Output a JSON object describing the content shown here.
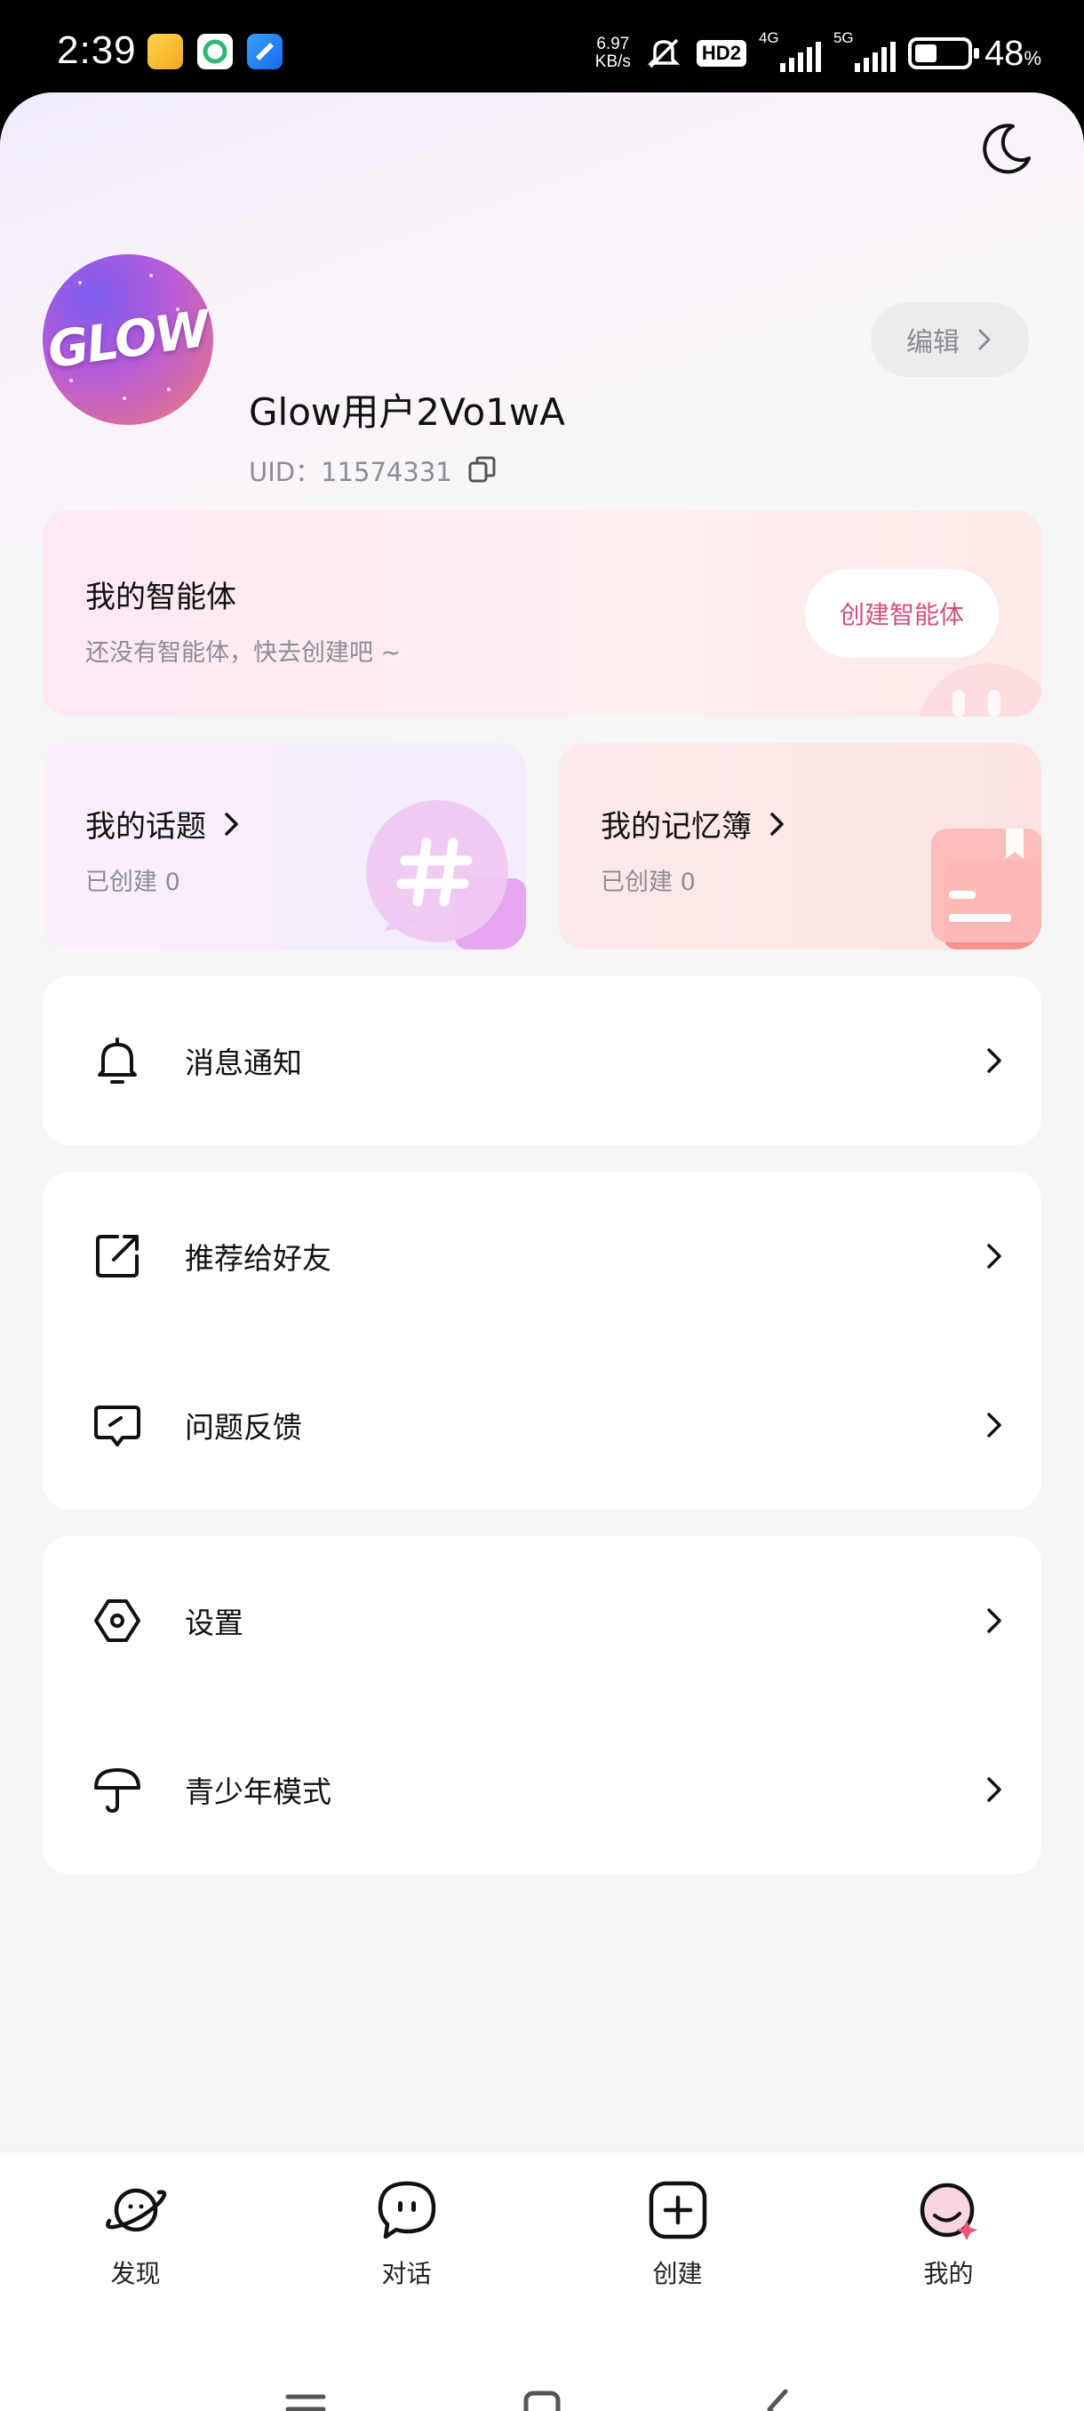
{
  "status_bar": {
    "time": "2:39",
    "net_speed_value": "6.97",
    "net_speed_unit": "KB/s",
    "hd_label": "HD2",
    "net1": "4G",
    "net2": "5G",
    "battery_value": "48",
    "battery_unit": "%",
    "battery_level": 0.48
  },
  "profile": {
    "username": "Glow用户2Vo1wA",
    "uid_label": "UID：",
    "uid_value": "11574331",
    "edit_label": "编辑",
    "avatar_logo": "GLOW"
  },
  "agents": {
    "title": "我的智能体",
    "subtitle": "还没有智能体，快去创建吧 ~",
    "create_label": "创建智能体"
  },
  "topics": {
    "title": "我的话题",
    "subtitle": "已创建 0"
  },
  "memo": {
    "title": "我的记忆簿",
    "subtitle": "已创建 0"
  },
  "menu_group1": [
    {
      "label": "消息通知",
      "icon": "bell-icon"
    }
  ],
  "menu_group2": [
    {
      "label": "推荐给好友",
      "icon": "share-icon"
    },
    {
      "label": "问题反馈",
      "icon": "feedback-icon"
    }
  ],
  "menu_group3": [
    {
      "label": "设置",
      "icon": "settings-icon"
    },
    {
      "label": "青少年模式",
      "icon": "umbrella-icon"
    }
  ],
  "bottom_nav": [
    {
      "label": "发现",
      "icon": "planet-icon"
    },
    {
      "label": "对话",
      "icon": "chat-icon"
    },
    {
      "label": "创建",
      "icon": "plus-square-icon"
    },
    {
      "label": "我的",
      "icon": "profile-avatar-icon",
      "selected": true
    }
  ],
  "colors": {
    "accent": "#d2507a",
    "text": "#111111",
    "muted": "#8d8d93",
    "background": "#f6f6f7"
  }
}
